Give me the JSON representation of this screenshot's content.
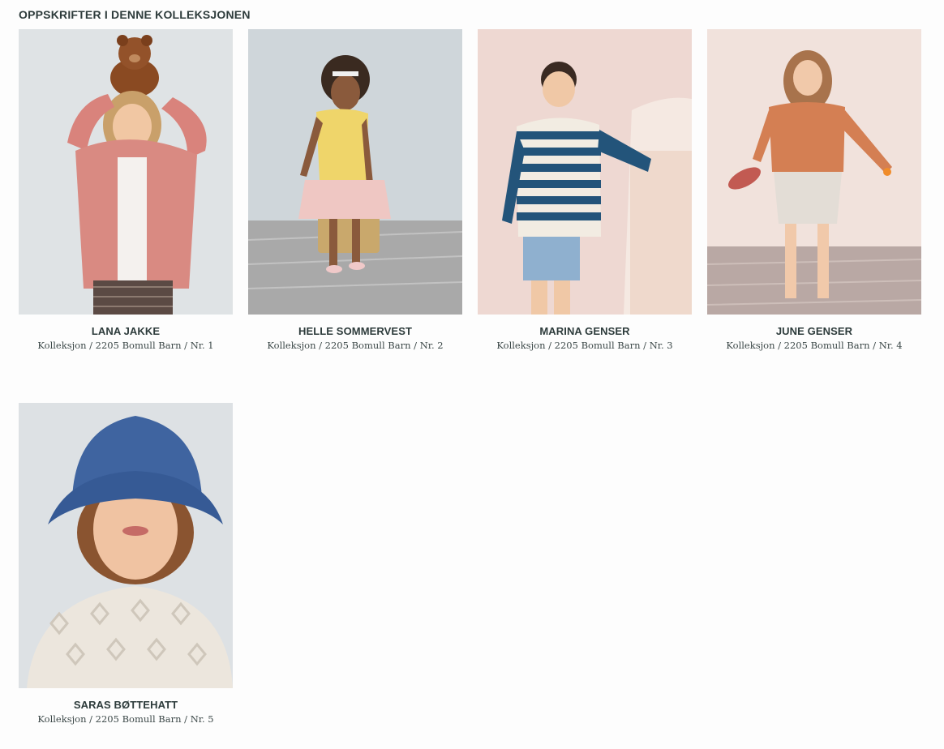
{
  "section": {
    "title": "OPPSKRIFTER I DENNE KOLLEKSJONEN"
  },
  "patterns": [
    {
      "name": "LANA JAKKE",
      "subtitle": "Kolleksjon / 2205 Bomull Barn / Nr. 1",
      "image_icon": "girl-pink-cardigan-teddy-photo"
    },
    {
      "name": "HELLE SOMMERVEST",
      "subtitle": "Kolleksjon / 2205 Bomull Barn / Nr. 2",
      "image_icon": "girl-yellow-vest-photo"
    },
    {
      "name": "MARINA GENSER",
      "subtitle": "Kolleksjon / 2205 Bomull Barn / Nr. 3",
      "image_icon": "boy-striped-sweater-photo"
    },
    {
      "name": "JUNE GENSER",
      "subtitle": "Kolleksjon / 2205 Bomull Barn / Nr. 4",
      "image_icon": "girl-orange-sweater-photo"
    },
    {
      "name": "SARAS BØTTEHATT",
      "subtitle": "Kolleksjon / 2205 Bomull Barn / Nr. 5",
      "image_icon": "child-blue-bucket-hat-photo"
    }
  ],
  "colors": {
    "heading": "#2d3b3b",
    "background": "#fdfdfd"
  }
}
